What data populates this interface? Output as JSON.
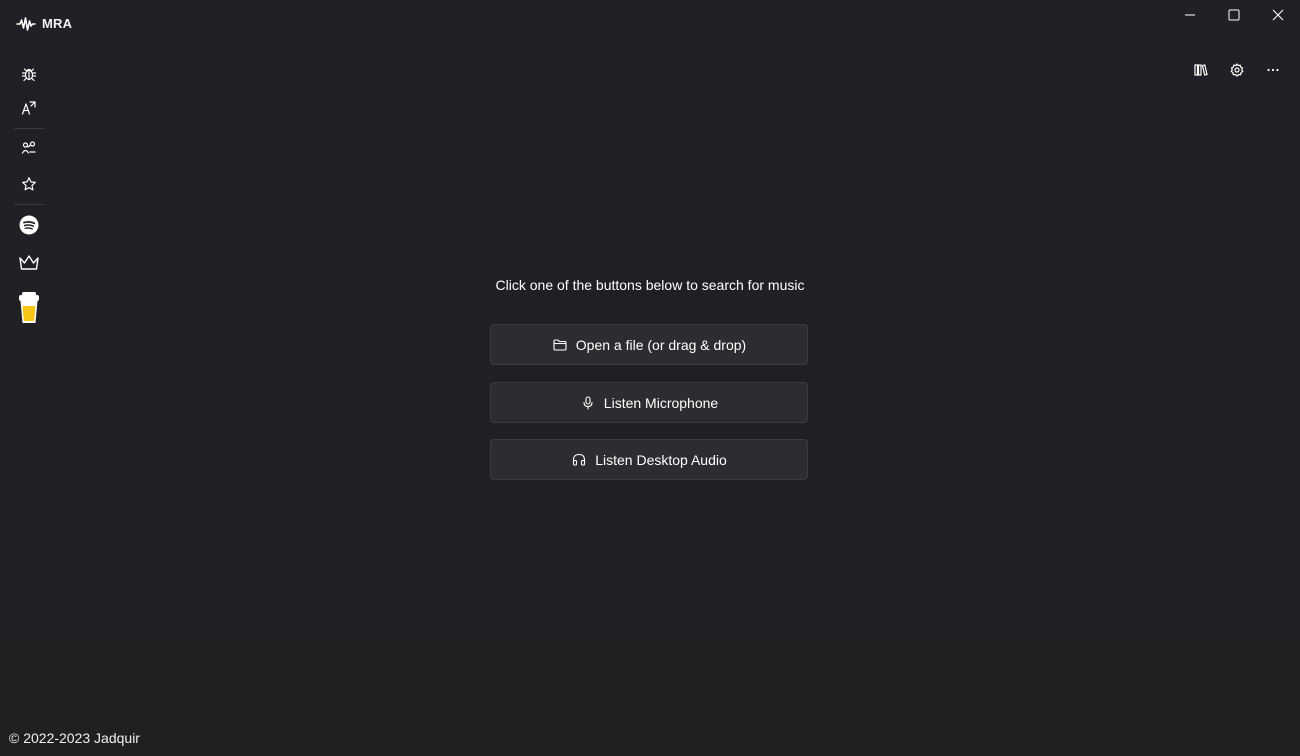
{
  "app": {
    "title": "MRA",
    "logo_icon": "waveform-icon"
  },
  "window_controls": {
    "minimize_icon": "minimize-icon",
    "maximize_icon": "maximize-icon",
    "close_icon": "close-icon"
  },
  "sidebar": {
    "items": [
      {
        "icon": "bug-icon"
      },
      {
        "icon": "translate-icon"
      },
      {
        "icon": "connections-icon"
      },
      {
        "icon": "star-icon"
      },
      {
        "icon": "spotify-icon"
      },
      {
        "icon": "crown-icon"
      },
      {
        "icon": "coffee-cup-icon"
      }
    ]
  },
  "toolbar": {
    "library_icon": "library-icon",
    "settings_icon": "gear-icon",
    "more_icon": "more-icon"
  },
  "main": {
    "prompt": "Click one of the buttons below to search for music",
    "buttons": [
      {
        "label": "Open a file (or drag & drop)",
        "icon": "folder-icon"
      },
      {
        "label": "Listen Microphone",
        "icon": "microphone-icon"
      },
      {
        "label": "Listen Desktop Audio",
        "icon": "headphones-icon"
      }
    ]
  },
  "footer": {
    "copyright": "© 2022-2023 Jadquir"
  },
  "colors": {
    "background": "#202024",
    "button_bg": "#2c2c31",
    "button_border": "#3b3b41",
    "coffee_yellow": "#f5c518",
    "text": "#ffffff"
  }
}
